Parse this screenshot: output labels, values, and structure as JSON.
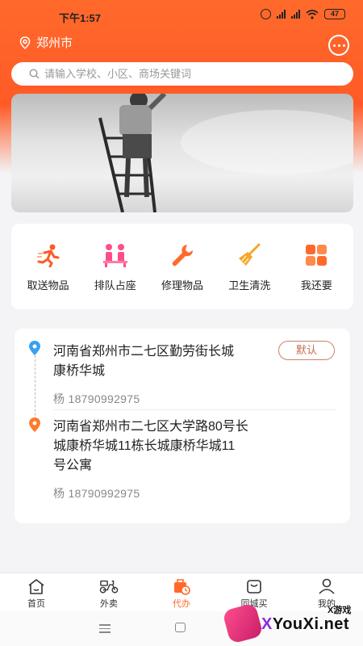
{
  "status_bar": {
    "time": "下午1:57",
    "battery": "47"
  },
  "header": {
    "city": "郑州市"
  },
  "search": {
    "placeholder": "请输入学校、小区、商场关键词"
  },
  "services": [
    {
      "label": "取送物品",
      "icon": "running-person-icon",
      "color": "#ff5a26"
    },
    {
      "label": "排队占座",
      "icon": "queue-people-icon",
      "color": "#ff4d8d"
    },
    {
      "label": "修理物品",
      "icon": "wrench-icon",
      "color": "#ff6a2b"
    },
    {
      "label": "卫生清洗",
      "icon": "broom-icon",
      "color": "#f5a623"
    },
    {
      "label": "我还要",
      "icon": "grid-more-icon",
      "color": "#ff6a2b"
    }
  ],
  "addresses": [
    {
      "line1": "河南省郑州市二七区勤劳街长城",
      "line2": "康桥华城",
      "contact": "杨 18790992975",
      "badge": "默认"
    },
    {
      "line1": "河南省郑州市二七区大学路80号长",
      "line2": "城康桥华城11栋长城康桥华城11",
      "line3": "号公寓",
      "contact": "杨 18790992975"
    }
  ],
  "tabs": [
    {
      "label": "首页",
      "icon": "home-icon"
    },
    {
      "label": "外卖",
      "icon": "scooter-icon"
    },
    {
      "label": "代办",
      "icon": "errand-icon",
      "active": true
    },
    {
      "label": "同城买",
      "icon": "shopping-bag-icon"
    },
    {
      "label": "我的",
      "icon": "user-icon"
    }
  ],
  "watermark": {
    "small": "X游戏",
    "big_prefix": "X",
    "big_rest": "YouXi.net"
  },
  "colors": {
    "primary": "#ff6a2b",
    "default_badge": "#c56d4e",
    "pin_blue": "#3aa0f0",
    "pin_orange": "#ff7a2b"
  }
}
